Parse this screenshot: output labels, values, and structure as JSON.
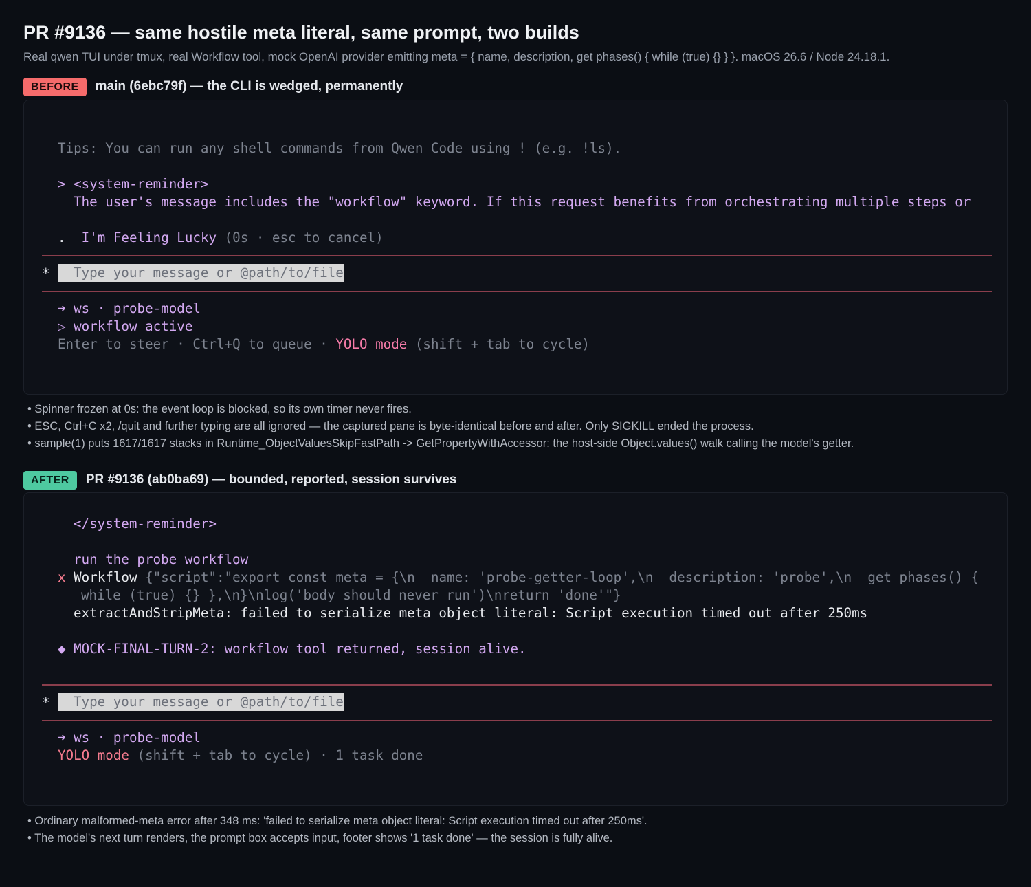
{
  "header": {
    "title": "PR #9136 — same hostile meta literal, same prompt, two builds",
    "subtitle": "Real qwen TUI under tmux, real Workflow tool, mock OpenAI provider emitting meta = { name, description, get phases() { while (true) {} } }. macOS 26.6 / Node 24.18.1."
  },
  "before": {
    "badge": "BEFORE",
    "title": "main (6ebc79f) — the CLI is wedged, permanently",
    "terminal": {
      "tips": "Tips: You can run any shell commands from Qwen Code using ! (e.g. !ls).",
      "reminder_prefix": "> ",
      "reminder_tag": "<system-reminder>",
      "reminder_text": "The user's message includes the \"workflow\" keyword. If this request benefits from orchestrating multiple steps or",
      "spinner_dot": ".",
      "spinner_phrase": "I'm Feeling Lucky",
      "spinner_meta": "(0s · esc to cancel)",
      "prompt_marker": "*",
      "prompt_placeholder": "Type your message or @path/to/file",
      "model_line": "➜ ws · probe-model",
      "workflow_line": "▷ workflow active",
      "footer_left": "Enter to steer · Ctrl+Q to queue · ",
      "footer_yolo": "YOLO mode",
      "footer_right": " (shift + tab to cycle)"
    },
    "notes": [
      "• Spinner frozen at 0s: the event loop is blocked, so its own timer never fires.",
      "• ESC, Ctrl+C x2, /quit and further typing are all ignored — the captured pane is byte-identical before and after. Only SIGKILL ended the process.",
      "• sample(1) puts 1617/1617 stacks in Runtime_ObjectValuesSkipFastPath -> GetPropertyWithAccessor: the host-side Object.values() walk calling the model's getter."
    ]
  },
  "after": {
    "badge": "AFTER",
    "title": "PR #9136 (ab0ba69) — bounded, reported, session survives",
    "terminal": {
      "reminder_close": "</system-reminder>",
      "user_msg": "run the probe workflow",
      "x_mark": "x",
      "tool_name": "Workflow",
      "tool_args_1": " {\"script\":\"export const meta = {\\n  name: 'probe-getter-loop',\\n  description: 'probe',\\n  get phases() {",
      "tool_args_2": "while (true) {} },\\n}\\nlog('body should never run')\\nreturn 'done'\"}",
      "error_line": "extractAndStripMeta: failed to serialize meta object literal: Script execution timed out after 250ms",
      "final_marker": "◆",
      "final_text": "MOCK-FINAL-TURN-2: workflow tool returned, session alive.",
      "prompt_marker": "*",
      "prompt_placeholder": "Type your message or @path/to/file",
      "model_line": "➜ ws · probe-model",
      "footer_yolo": "YOLO mode",
      "footer_right": " (shift + tab to cycle) · 1 task done"
    },
    "notes": [
      "• Ordinary malformed-meta error after 348 ms: 'failed to serialize meta object literal: Script execution timed out after 250ms'.",
      "• The model's next turn renders, the prompt box accepts input, footer shows '1 task done' — the session is fully alive."
    ]
  },
  "colors": {
    "background": "#0b0e14",
    "before_badge": "#f56b6b",
    "after_badge": "#4ec9a0",
    "accent_purple": "#d2a8f0",
    "yolo_pink": "#f47ba8",
    "divider": "#8a3e4c"
  }
}
